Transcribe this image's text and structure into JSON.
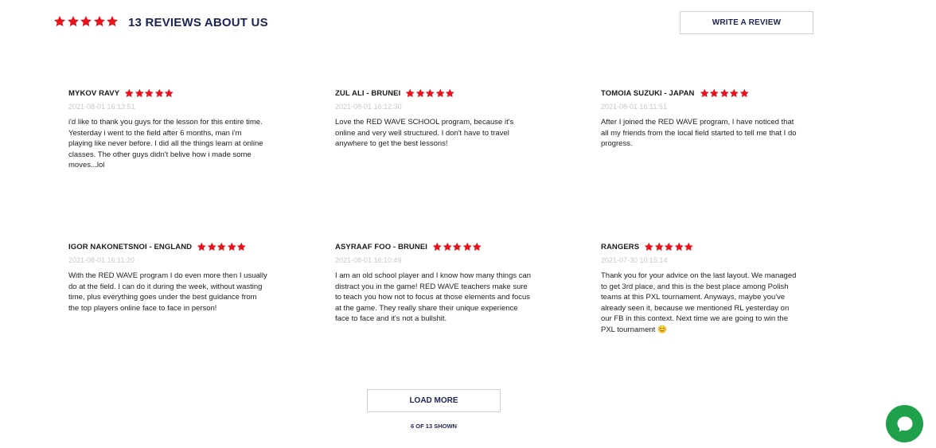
{
  "header": {
    "title": "13 REVIEWS ABOUT US",
    "rating_stars": 5,
    "write_review_label": "WRITE A REVIEW"
  },
  "colors": {
    "star": "#e8121c",
    "accent_navy": "#1b2553",
    "chat_green": "#1fa04a",
    "date_gray": "#c8c8c8"
  },
  "reviews": [
    {
      "name": "MYKOV RAVY",
      "stars": 5,
      "date": "2021-08-01 16:13:51",
      "text": "i'd like to thank you guys for the lesson for this entire time. Yesterday i went to the field after 6 months, man i'm playing like never before. I did all the things learn at online classes. The other guys didn't belive how i made some moves...lol"
    },
    {
      "name": "ZUL ALI - BRUNEI",
      "stars": 5,
      "date": "2021-08-01 16:12:30",
      "text": "Love the RED WAVE SCHOOL program, because it's online and very well structured. I don't have to travel anywhere to get the best lessons!"
    },
    {
      "name": "TOMOIA SUZUKI - JAPAN",
      "stars": 5,
      "date": "2021-08-01 16:11:51",
      "text": "After I joined the RED WAVE program, I have noticed that all my friends from the local field started to tell me that I do progress."
    },
    {
      "name": "IGOR NAKONETSNOI - ENGLAND",
      "stars": 5,
      "date": "2021-08-01 16:11:20",
      "text": "With the RED WAVE program I do even more then I usually do at the field. I can do it during the week, without wasting time, plus everything goes under the best guidance from the top players online face to face in person!"
    },
    {
      "name": "ASYRAAF FOO - BRUNEI",
      "stars": 5,
      "date": "2021-08-01 16:10:49",
      "text": "I am an old school player and I know how many things can distract you in the game! RED WAVE teachers make sure to teach you how not to focus at those elements and focus at the game. They really share their unique experience face to face and it's not a bullshit."
    },
    {
      "name": "RANGERS",
      "stars": 5,
      "date": "2021-07-30 10:15:14",
      "text": "Thank you for your advice on the last layout. We managed to get 3rd place, and this is the best place among Polish teams at this PXL tournament. Anyways, maybe you've already seen it, because we mentioned RL yesterday on our FB in this context. Next time we are going to win the PXL tournament 😊"
    }
  ],
  "footer": {
    "load_more_label": "LOAD MORE",
    "shown_text": "6 OF 13 SHOWN"
  },
  "chat": {
    "icon": "chat-bubble-icon"
  }
}
